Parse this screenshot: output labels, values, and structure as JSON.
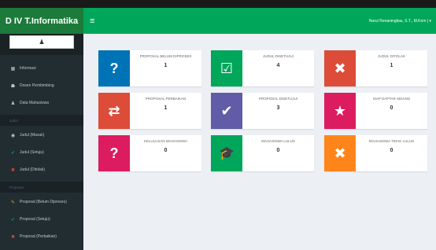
{
  "brand": "D IV T.Informatika",
  "topbar": {
    "toggle_icon": "≡",
    "user": "Nurul Renaningtias, S.T., M.Kom | ▾"
  },
  "sidebar": {
    "avatar_icon": "user-icon",
    "items": [
      {
        "label": "Informasi",
        "icon": "▦",
        "icon_color": "#b8c7ce"
      },
      {
        "label": "Dosen Pembimbing",
        "icon": "☗",
        "icon_color": "#b8c7ce"
      },
      {
        "label": "Data Mahasiswa",
        "icon": "♟",
        "icon_color": "#b8c7ce"
      }
    ],
    "header1": "Judul",
    "judul_items": [
      {
        "label": "Judul (Masuk)",
        "icon": "◉",
        "icon_color": "#b8c7ce"
      },
      {
        "label": "Judul (Setuju)",
        "icon": "✔",
        "icon_color": "#00a65a"
      },
      {
        "label": "Judul (Ditolak)",
        "icon": "✖",
        "icon_color": "#dd4b39"
      }
    ],
    "header2": "Proposal",
    "proposal_items": [
      {
        "label": "Proposal (Belum Diproses)",
        "icon": "✎",
        "icon_color": "#f39c12"
      },
      {
        "label": "Proposal (Setuju)",
        "icon": "✔",
        "icon_color": "#00a65a"
      },
      {
        "label": "Proposal (Perbaikan)",
        "icon": "✖",
        "icon_color": "#dd4b39"
      }
    ]
  },
  "boxes": [
    {
      "label": "PROPOSAL BELUM DIPROSES",
      "value": "1",
      "icon": "?",
      "color": "#0073b7",
      "icon_name": "question-icon"
    },
    {
      "label": "JUDUL DISETUJUI",
      "value": "4",
      "icon": "☑",
      "color": "#00a65a",
      "icon_name": "check-square-icon"
    },
    {
      "label": "JUDUL DITOLAK",
      "value": "1",
      "icon": "✖",
      "color": "#dd4b39",
      "icon_name": "times-icon"
    },
    {
      "label": "PROPOSAL PERBAIKAN",
      "value": "1",
      "icon": "⇄",
      "color": "#dd4b39",
      "icon_name": "retweet-icon"
    },
    {
      "label": "PROPOSAL DISETUJUI",
      "value": "3",
      "icon": "✔",
      "color": "#605ca8",
      "icon_name": "check-icon"
    },
    {
      "label": "SIAP DAFTAR SIDANG",
      "value": "0",
      "icon": "★",
      "color": "#dd1c5f",
      "icon_name": "star-icon"
    },
    {
      "label": "KELULUSAN MAHASISWA",
      "value": "0",
      "icon": "?",
      "color": "#dd1c5f",
      "icon_name": "question-icon"
    },
    {
      "label": "MAHASISWA LULUS",
      "value": "0",
      "icon": "🎓",
      "color": "#00a65a",
      "icon_name": "graduation-cap-icon"
    },
    {
      "label": "MAHASISWA TIDAK LULUS",
      "value": "0",
      "icon": "✖",
      "color": "#ff851b",
      "icon_name": "times-icon"
    }
  ]
}
